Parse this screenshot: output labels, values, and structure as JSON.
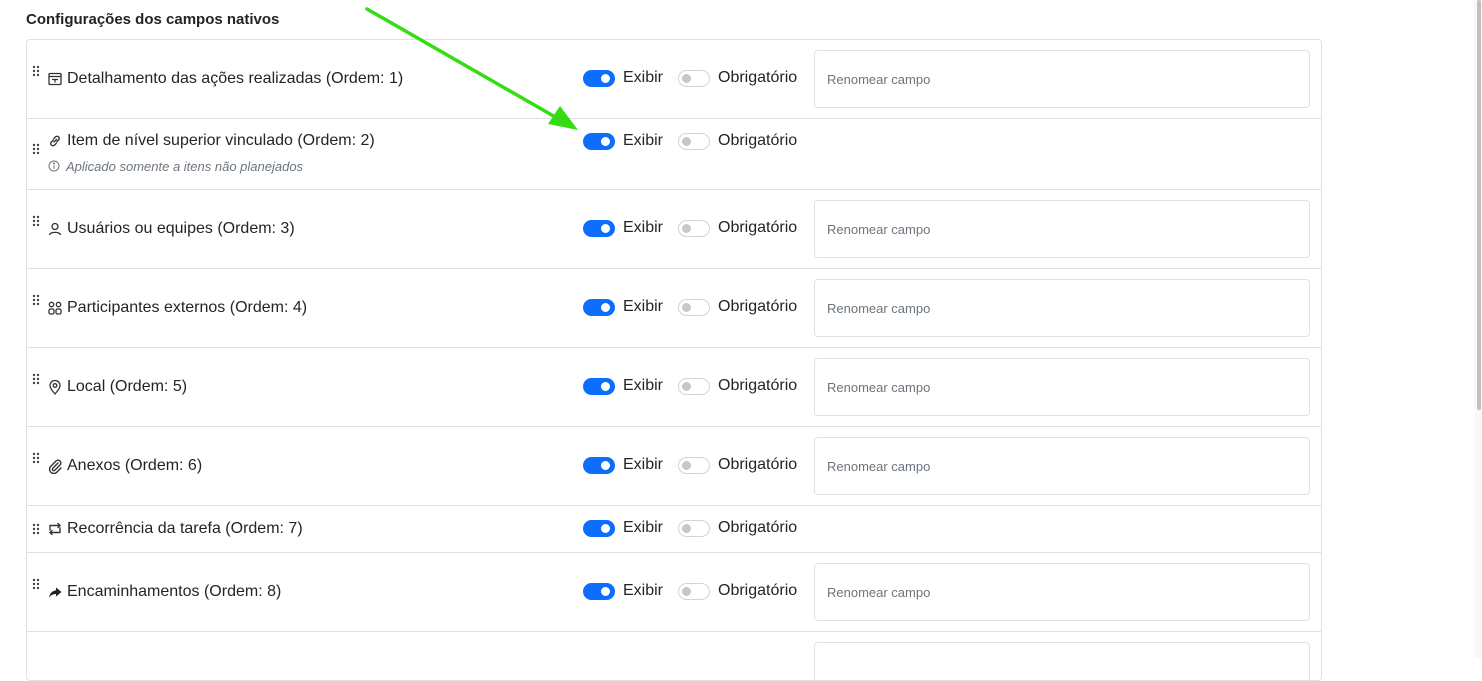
{
  "section": {
    "title": "Configurações dos campos nativos"
  },
  "labels": {
    "show": "Exibir",
    "required": "Obrigatório",
    "rename_placeholder": "Renomear campo"
  },
  "fields": [
    {
      "label": "Detalhamento das ações realizadas (Ordem: 1)",
      "icon": "text-box-icon",
      "show": true,
      "required": false,
      "has_rename": true
    },
    {
      "label": "Item de nível superior vinculado (Ordem: 2)",
      "icon": "link-icon",
      "show": true,
      "required": false,
      "has_rename": false,
      "note": "Aplicado somente a itens não planejados"
    },
    {
      "label": "Usuários ou equipes (Ordem: 3)",
      "icon": "user-icon",
      "show": true,
      "required": false,
      "has_rename": true
    },
    {
      "label": "Participantes externos (Ordem: 4)",
      "icon": "users-group-icon",
      "show": true,
      "required": false,
      "has_rename": true
    },
    {
      "label": "Local (Ordem: 5)",
      "icon": "map-pin-icon",
      "show": true,
      "required": false,
      "has_rename": true
    },
    {
      "label": "Anexos (Ordem: 6)",
      "icon": "paperclip-icon",
      "show": true,
      "required": false,
      "has_rename": true
    },
    {
      "label": "Recorrência da tarefa (Ordem: 7)",
      "icon": "repeat-icon",
      "show": true,
      "required": false,
      "has_rename": false
    },
    {
      "label": "Encaminhamentos (Ordem: 8)",
      "icon": "forward-arrow-icon",
      "show": true,
      "required": false,
      "has_rename": true
    },
    {
      "label": "",
      "icon": "",
      "show": true,
      "required": false,
      "has_rename": true
    }
  ],
  "colors": {
    "toggle_on": "#0d6efd",
    "annotation_arrow": "#33dd11"
  }
}
